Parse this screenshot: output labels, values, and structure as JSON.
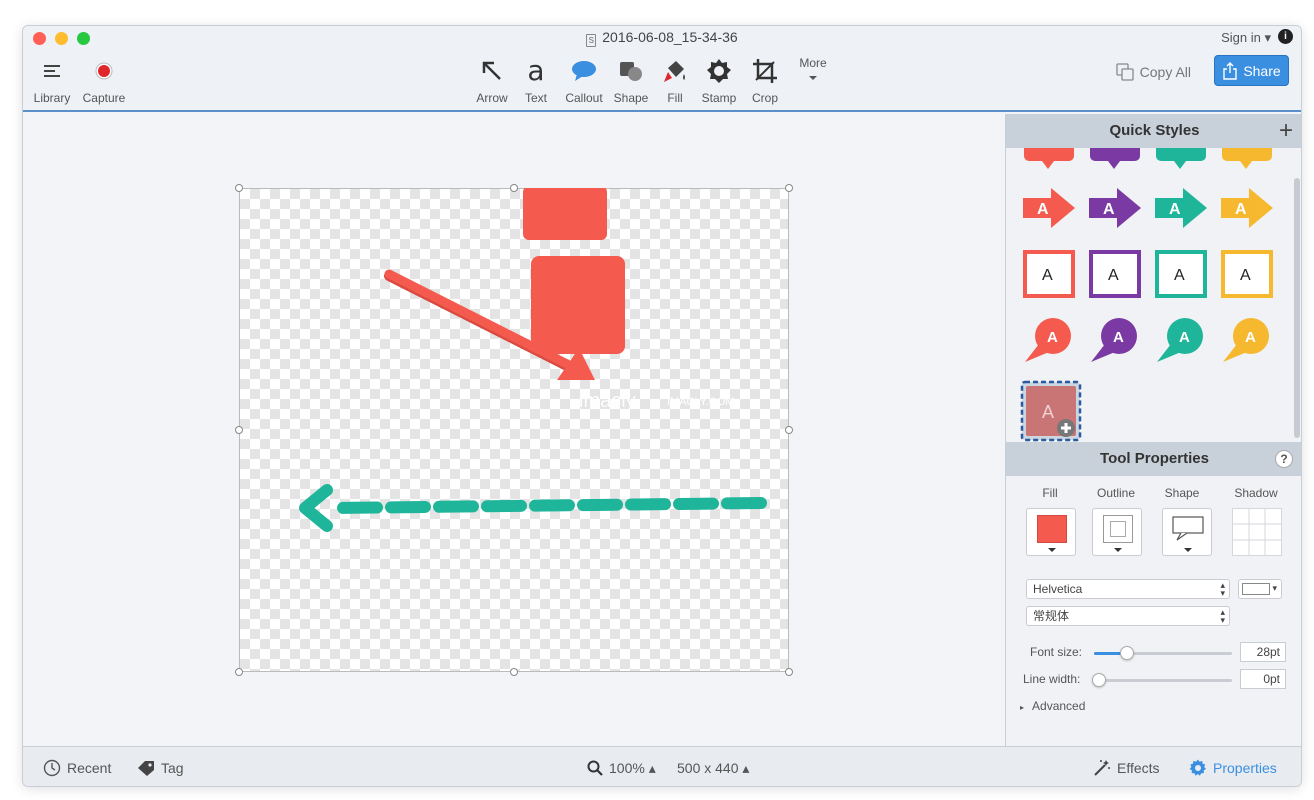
{
  "window": {
    "title": "2016-06-08_15-34-36",
    "doc_icon": "S",
    "signin": "Sign in ▾"
  },
  "toolbar": {
    "left": [
      {
        "label": "Library",
        "icon": "list-icon"
      },
      {
        "label": "Capture",
        "icon": "record-icon"
      }
    ],
    "tools": [
      {
        "label": "Arrow",
        "icon": "arrow-icon"
      },
      {
        "label": "Text",
        "icon": "text-icon"
      },
      {
        "label": "Callout",
        "icon": "callout-icon"
      },
      {
        "label": "Shape",
        "icon": "shape-icon"
      },
      {
        "label": "Fill",
        "icon": "fill-icon"
      },
      {
        "label": "Stamp",
        "icon": "stamp-icon"
      },
      {
        "label": "Crop",
        "icon": "crop-icon"
      },
      {
        "label": "More",
        "icon": "chevron-down-icon"
      }
    ],
    "copy_all": "Copy All",
    "share": "Share"
  },
  "canvas": {
    "watermark": "imacly",
    "watermark_small": "IMACLY.COM"
  },
  "quick_styles": {
    "title": "Quick Styles",
    "colors": [
      "#f45a4e",
      "#7b3aa3",
      "#1eb59a",
      "#f5b82e"
    ],
    "glyph": "A"
  },
  "tool_properties": {
    "title": "Tool Properties",
    "help": "?",
    "columns": [
      "Fill",
      "Outline",
      "Shape",
      "Shadow"
    ],
    "fill_color": "#f45a4e",
    "font_family": "Helvetica",
    "font_style": "常规体",
    "font_size_label": "Font size:",
    "font_size_value": "28pt",
    "font_size_level": 0.2,
    "line_width_label": "Line width:",
    "line_width_value": "0pt",
    "line_width_level": 0,
    "advanced": "Advanced"
  },
  "bottombar": {
    "recent": "Recent",
    "tag": "Tag",
    "zoom": "100% ▴",
    "dimensions": "500 x 440 ▴",
    "effects": "Effects",
    "properties": "Properties"
  },
  "colors": {
    "accent": "#3b8fe0",
    "red": "#f45a4e",
    "teal": "#1eb59a"
  }
}
